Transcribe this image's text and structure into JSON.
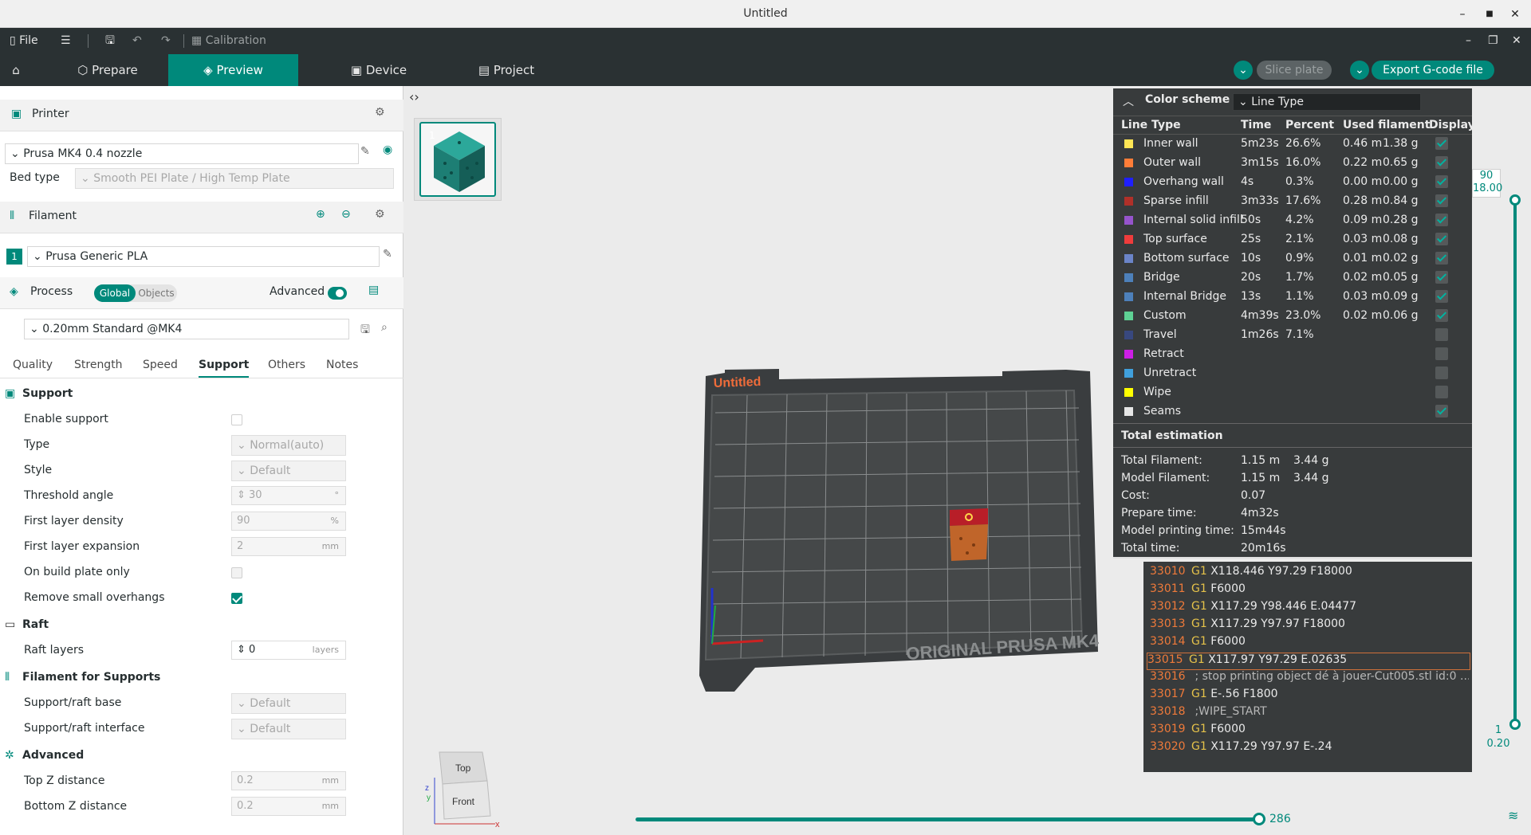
{
  "window": {
    "title": "Untitled"
  },
  "menubar": {
    "file": "File",
    "calibration": "Calibration"
  },
  "tabs": {
    "prepare": "Prepare",
    "preview": "Preview",
    "device": "Device",
    "project": "Project"
  },
  "actions": {
    "slice_plate": "Slice plate",
    "export": "Export G-code file"
  },
  "printer": {
    "section": "Printer",
    "name": "Prusa MK4 0.4 nozzle",
    "bed_type_label": "Bed type",
    "bed_type_value": "Smooth PEI Plate / High Temp Plate"
  },
  "filament": {
    "section": "Filament",
    "index": "1",
    "name": "Prusa Generic PLA"
  },
  "process": {
    "section": "Process",
    "global": "Global",
    "objects": "Objects",
    "advanced": "Advanced",
    "preset": "0.20mm Standard @MK4"
  },
  "subtabs": [
    "Quality",
    "Strength",
    "Speed",
    "Support",
    "Others",
    "Notes"
  ],
  "support": {
    "group": "Support",
    "enable": "Enable support",
    "type_label": "Type",
    "type_value": "Normal(auto)",
    "style_label": "Style",
    "style_value": "Default",
    "threshold_label": "Threshold angle",
    "threshold_value": "30",
    "threshold_unit": "°",
    "fld_label": "First layer density",
    "fld_value": "90",
    "fld_unit": "%",
    "fle_label": "First layer expansion",
    "fle_value": "2",
    "fle_unit": "mm",
    "obpo_label": "On build plate only",
    "rso_label": "Remove small overhangs",
    "raft_group": "Raft",
    "raft_layers_label": "Raft layers",
    "raft_layers_value": "0",
    "raft_layers_unit": "layers",
    "ffs_group": "Filament for Supports",
    "base_label": "Support/raft base",
    "base_value": "Default",
    "iface_label": "Support/raft interface",
    "iface_value": "Default",
    "adv_group": "Advanced",
    "topz_label": "Top Z distance",
    "topz_value": "0.2",
    "topz_unit": "mm",
    "botz_label": "Bottom Z distance",
    "botz_value": "0.2",
    "botz_unit": "mm"
  },
  "plate": {
    "thumb_index": "1",
    "label": "Untitled",
    "brand": "ORIGINAL PRUSA MK4"
  },
  "viewcube": {
    "top": "Top",
    "front": "Front",
    "x": "x",
    "y": "y",
    "z": "z"
  },
  "legend": {
    "color_scheme_label": "Color scheme",
    "color_scheme_value": "Line Type",
    "headers": {
      "type": "Line Type",
      "time": "Time",
      "percent": "Percent",
      "used": "Used filament",
      "display": "Display"
    },
    "rows": [
      {
        "name": "Inner wall",
        "color": "#ffe655",
        "time": "5m23s",
        "pct": "26.6%",
        "m": "0.46 m",
        "g": "1.38 g",
        "on": true
      },
      {
        "name": "Outer wall",
        "color": "#ff7d38",
        "time": "3m15s",
        "pct": "16.0%",
        "m": "0.22 m",
        "g": "0.65 g",
        "on": true
      },
      {
        "name": "Overhang wall",
        "color": "#1f1fff",
        "time": "4s",
        "pct": "0.3%",
        "m": "0.00 m",
        "g": "0.00 g",
        "on": true
      },
      {
        "name": "Sparse infill",
        "color": "#b03029",
        "time": "3m33s",
        "pct": "17.6%",
        "m": "0.28 m",
        "g": "0.84 g",
        "on": true
      },
      {
        "name": "Internal solid infill",
        "color": "#9654cc",
        "time": "50s",
        "pct": "4.2%",
        "m": "0.09 m",
        "g": "0.28 g",
        "on": true
      },
      {
        "name": "Top surface",
        "color": "#f03c3c",
        "time": "25s",
        "pct": "2.1%",
        "m": "0.03 m",
        "g": "0.08 g",
        "on": true
      },
      {
        "name": "Bottom surface",
        "color": "#6b84c8",
        "time": "10s",
        "pct": "0.9%",
        "m": "0.01 m",
        "g": "0.02 g",
        "on": true
      },
      {
        "name": "Bridge",
        "color": "#4d80ba",
        "time": "20s",
        "pct": "1.7%",
        "m": "0.02 m",
        "g": "0.05 g",
        "on": true
      },
      {
        "name": "Internal Bridge",
        "color": "#4d80ba",
        "time": "13s",
        "pct": "1.1%",
        "m": "0.03 m",
        "g": "0.09 g",
        "on": true
      },
      {
        "name": "Custom",
        "color": "#5ed194",
        "time": "4m39s",
        "pct": "23.0%",
        "m": "0.02 m",
        "g": "0.06 g",
        "on": true
      },
      {
        "name": "Travel",
        "color": "#38487f",
        "time": "1m26s",
        "pct": "7.1%",
        "m": "",
        "g": "",
        "on": false
      },
      {
        "name": "Retract",
        "color": "#cd1fe6",
        "time": "",
        "pct": "",
        "m": "",
        "g": "",
        "on": false
      },
      {
        "name": "Unretract",
        "color": "#40a0dc",
        "time": "",
        "pct": "",
        "m": "",
        "g": "",
        "on": false
      },
      {
        "name": "Wipe",
        "color": "#ffff00",
        "time": "",
        "pct": "",
        "m": "",
        "g": "",
        "on": false
      },
      {
        "name": "Seams",
        "color": "#e6e6e6",
        "time": "",
        "pct": "",
        "m": "",
        "g": "",
        "on": true
      }
    ],
    "total_title": "Total estimation",
    "totals": [
      {
        "k": "Total Filament:",
        "v1": "1.15 m",
        "v2": "3.44 g"
      },
      {
        "k": "Model Filament:",
        "v1": "1.15 m",
        "v2": "3.44 g"
      },
      {
        "k": "Cost:",
        "v1": "0.07",
        "v2": ""
      },
      {
        "k": "Prepare time:",
        "v1": "4m32s",
        "v2": ""
      },
      {
        "k": "Model printing time:",
        "v1": "15m44s",
        "v2": ""
      },
      {
        "k": "Total time:",
        "v1": "20m16s",
        "v2": ""
      }
    ]
  },
  "gcode": [
    {
      "n": "33010",
      "c": "G1",
      "a": "X118.446 Y97.29 F18000"
    },
    {
      "n": "33011",
      "c": "G1",
      "a": "F6000"
    },
    {
      "n": "33012",
      "c": "G1",
      "a": "X117.29 Y98.446 E.04477"
    },
    {
      "n": "33013",
      "c": "G1",
      "a": "X117.29 Y97.97 F18000"
    },
    {
      "n": "33014",
      "c": "G1",
      "a": "F6000"
    },
    {
      "n": "33015",
      "c": "G1",
      "a": "X117.97 Y97.29 E.02635"
    },
    {
      "n": "33016",
      "c": "",
      "a": "; stop printing object dé à jouer-Cut005.stl id:0 ..."
    },
    {
      "n": "33017",
      "c": "G1",
      "a": "E-.56 F1800"
    },
    {
      "n": "33018",
      "c": "",
      "a": ";WIPE_START"
    },
    {
      "n": "33019",
      "c": "G1",
      "a": "F6000"
    },
    {
      "n": "33020",
      "c": "G1",
      "a": "X117.29 Y97.97 E-.24"
    }
  ],
  "layer_slider": {
    "top_layer": "90",
    "top_z": "18.00",
    "bottom_layer": "1",
    "bottom_z": "0.20"
  },
  "move_slider": {
    "value": "286"
  }
}
